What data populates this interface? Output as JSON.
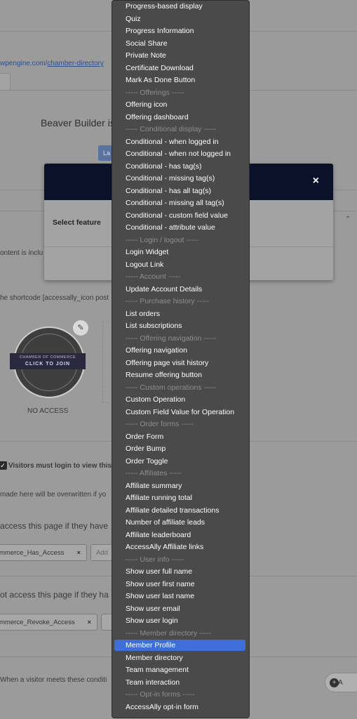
{
  "background": {
    "url_prefix": "wpengine.com/",
    "url_path": "chamber-directory",
    "builder_text": "Beaver Builder is",
    "launch_button": "La",
    "content_note": "ontent is inclu",
    "shortcode_note": "he shortcode [accessally_icon post",
    "badge_top": "CHAMBER OF COMMERCE",
    "badge_main": "CLICK TO JOIN",
    "pencil_icon": "✎",
    "no_access": "NO ACCESS",
    "login_check": "✓",
    "login_label": "Visitors must login to view this",
    "overwrite_note": "made here will be overwritten if yo",
    "access_heading": "access this page if they have",
    "access_tag": "mmerce_Has_Access",
    "access_add": "Add",
    "noaccess_heading": "ot access this page if they ha",
    "revoke_tag": "mmerce_Revoke_Access",
    "visitor_note": "When a visitor meets these conditi",
    "add_button": "A",
    "plus_icon": "+",
    "chevron_icon": "⌃"
  },
  "modal": {
    "close_icon": "×",
    "select_feature_label": "Select feature"
  },
  "dropdown": {
    "items": [
      {
        "label": "Progress-based display",
        "group": false
      },
      {
        "label": "Quiz",
        "group": false
      },
      {
        "label": "Progress Information",
        "group": false
      },
      {
        "label": "Social Share",
        "group": false
      },
      {
        "label": "Private Note",
        "group": false
      },
      {
        "label": "Certificate Download",
        "group": false
      },
      {
        "label": "Mark As Done Button",
        "group": false
      },
      {
        "label": "----- Offerings -----",
        "group": true
      },
      {
        "label": "Offering icon",
        "group": false
      },
      {
        "label": "Offering dashboard",
        "group": false
      },
      {
        "label": "----- Conditional display -----",
        "group": true
      },
      {
        "label": "Conditional - when logged in",
        "group": false
      },
      {
        "label": "Conditional - when not logged in",
        "group": false
      },
      {
        "label": "Conditional - has tag(s)",
        "group": false
      },
      {
        "label": "Conditional - missing tag(s)",
        "group": false
      },
      {
        "label": "Conditional - has all tag(s)",
        "group": false
      },
      {
        "label": "Conditional - missing all tag(s)",
        "group": false
      },
      {
        "label": "Conditional - custom field value",
        "group": false
      },
      {
        "label": "Conditional - attribute value",
        "group": false
      },
      {
        "label": "----- Login / logout -----",
        "group": true
      },
      {
        "label": "Login Widget",
        "group": false
      },
      {
        "label": "Logout Link",
        "group": false
      },
      {
        "label": "----- Account -----",
        "group": true
      },
      {
        "label": "Update Account Details",
        "group": false
      },
      {
        "label": "----- Purchase history -----",
        "group": true
      },
      {
        "label": "List orders",
        "group": false
      },
      {
        "label": "List subscriptions",
        "group": false
      },
      {
        "label": "----- Offering navigation -----",
        "group": true
      },
      {
        "label": "Offering navigation",
        "group": false
      },
      {
        "label": "Offering page visit history",
        "group": false
      },
      {
        "label": "Resume offering button",
        "group": false
      },
      {
        "label": "----- Custom operations -----",
        "group": true
      },
      {
        "label": "Custom Operation",
        "group": false
      },
      {
        "label": "Custom Field Value for Operation",
        "group": false
      },
      {
        "label": "----- Order forms -----",
        "group": true
      },
      {
        "label": "Order Form",
        "group": false
      },
      {
        "label": "Order Bump",
        "group": false
      },
      {
        "label": "Order Toggle",
        "group": false
      },
      {
        "label": "----- Affiliates -----",
        "group": true
      },
      {
        "label": "Affiliate summary",
        "group": false
      },
      {
        "label": "Affiliate running total",
        "group": false
      },
      {
        "label": "Affiliate detailed transactions",
        "group": false
      },
      {
        "label": "Number of affiliate leads",
        "group": false
      },
      {
        "label": "Affiliate leaderboard",
        "group": false
      },
      {
        "label": "AccessAlly Affiliate links",
        "group": false
      },
      {
        "label": "----- User info -----",
        "group": true
      },
      {
        "label": "Show user full name",
        "group": false
      },
      {
        "label": "Show user first name",
        "group": false
      },
      {
        "label": "Show user last name",
        "group": false
      },
      {
        "label": "Show user email",
        "group": false
      },
      {
        "label": "Show user login",
        "group": false
      },
      {
        "label": "----- Member directory -----",
        "group": true
      },
      {
        "label": "Member Profile",
        "group": false,
        "selected": true
      },
      {
        "label": "Member directory",
        "group": false
      },
      {
        "label": "Team management",
        "group": false
      },
      {
        "label": "Team interaction",
        "group": false
      },
      {
        "label": "----- Opt-in forms -----",
        "group": true
      },
      {
        "label": "AccessAlly opt-in form",
        "group": false
      }
    ]
  }
}
